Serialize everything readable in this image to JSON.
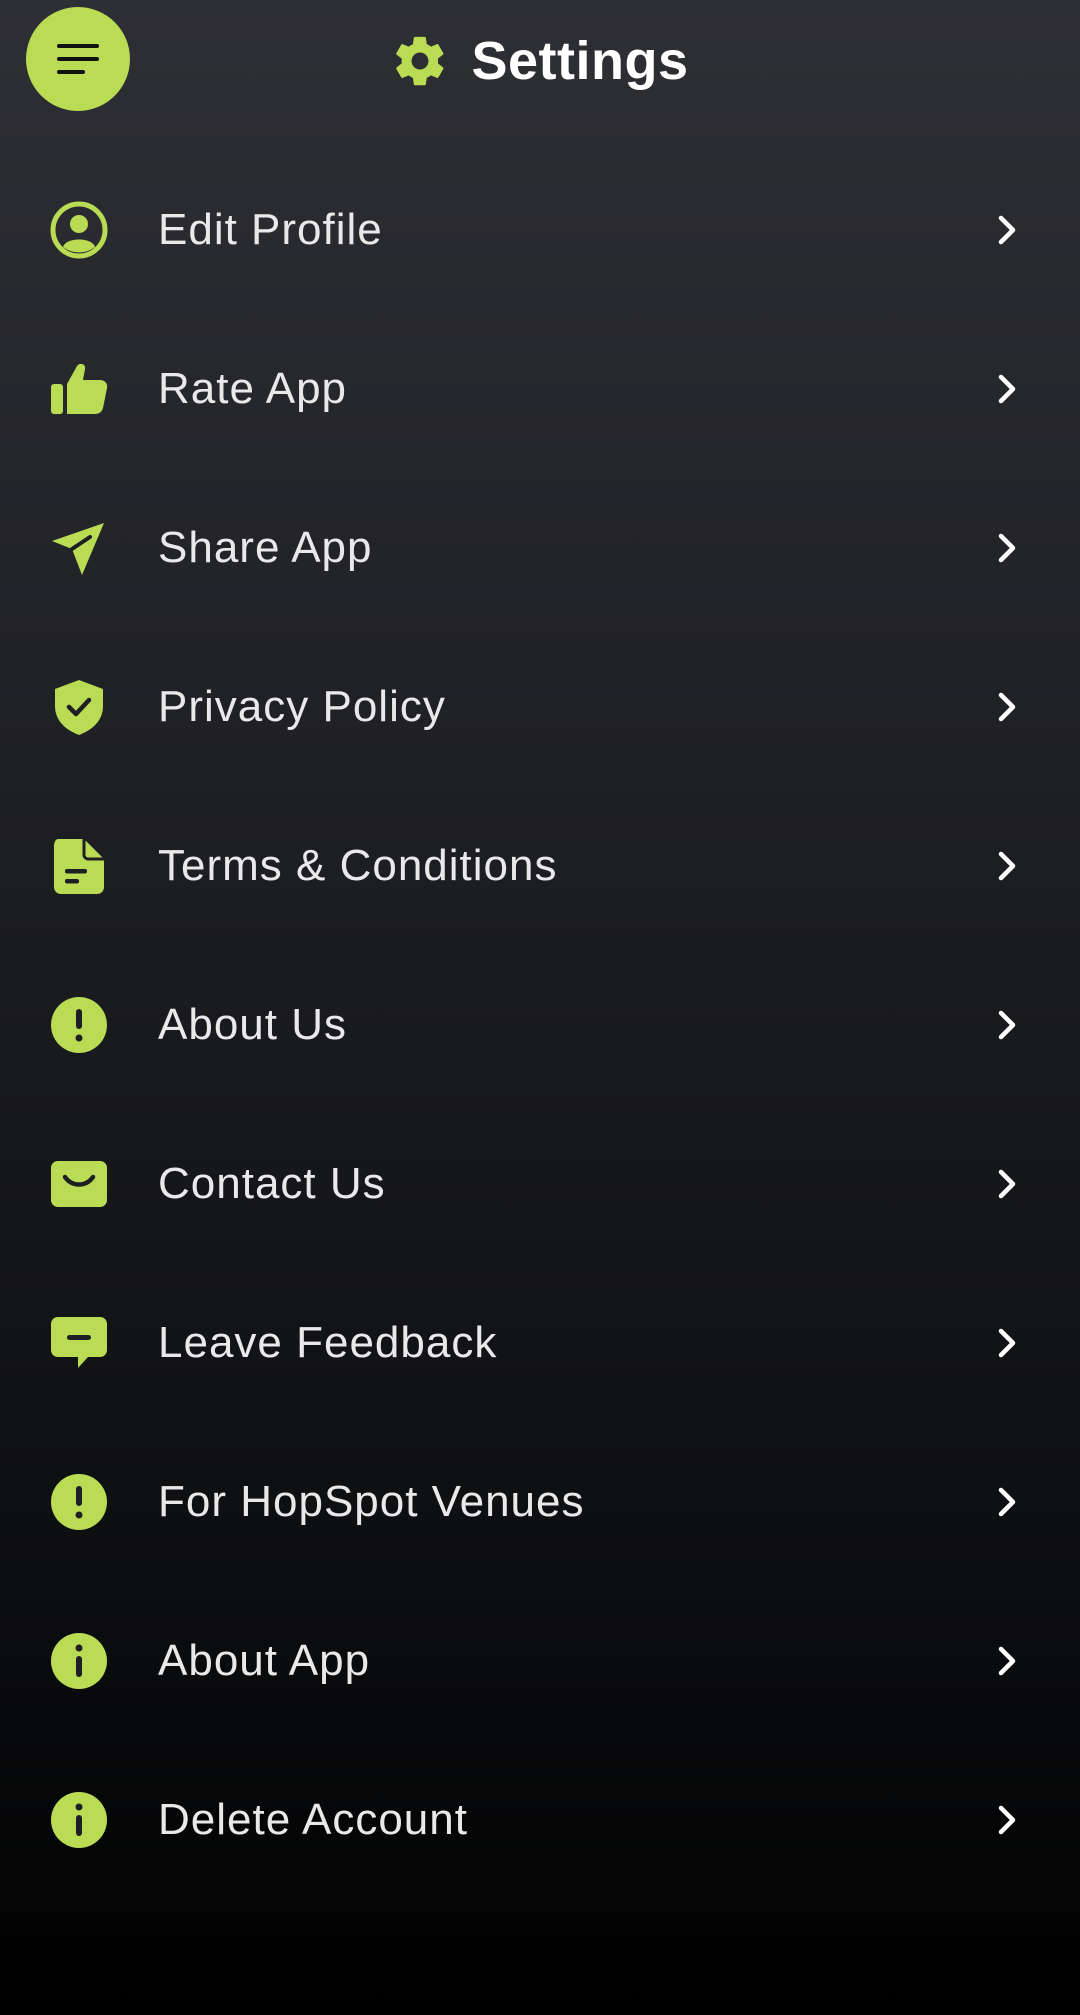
{
  "header": {
    "title": "Settings",
    "menu_icon": "hamburger-menu-icon",
    "title_icon": "gear-icon"
  },
  "colors": {
    "accent": "#b9dc54",
    "background_top": "#2e2f34",
    "background_bottom": "#000000",
    "text": "#e9e9e9"
  },
  "menu": {
    "items": [
      {
        "label": "Edit Profile",
        "icon": "user-circle-icon"
      },
      {
        "label": "Rate App",
        "icon": "thumbs-up-icon"
      },
      {
        "label": "Share App",
        "icon": "send-icon"
      },
      {
        "label": "Privacy Policy",
        "icon": "shield-check-icon"
      },
      {
        "label": "Terms & Conditions",
        "icon": "document-icon"
      },
      {
        "label": "About Us",
        "icon": "exclamation-circle-icon"
      },
      {
        "label": "Contact Us",
        "icon": "mail-icon"
      },
      {
        "label": "Leave Feedback",
        "icon": "chat-icon"
      },
      {
        "label": "For HopSpot Venues",
        "icon": "exclamation-circle-icon"
      },
      {
        "label": "About App",
        "icon": "info-circle-icon"
      },
      {
        "label": "Delete Account",
        "icon": "info-circle-icon"
      }
    ]
  }
}
